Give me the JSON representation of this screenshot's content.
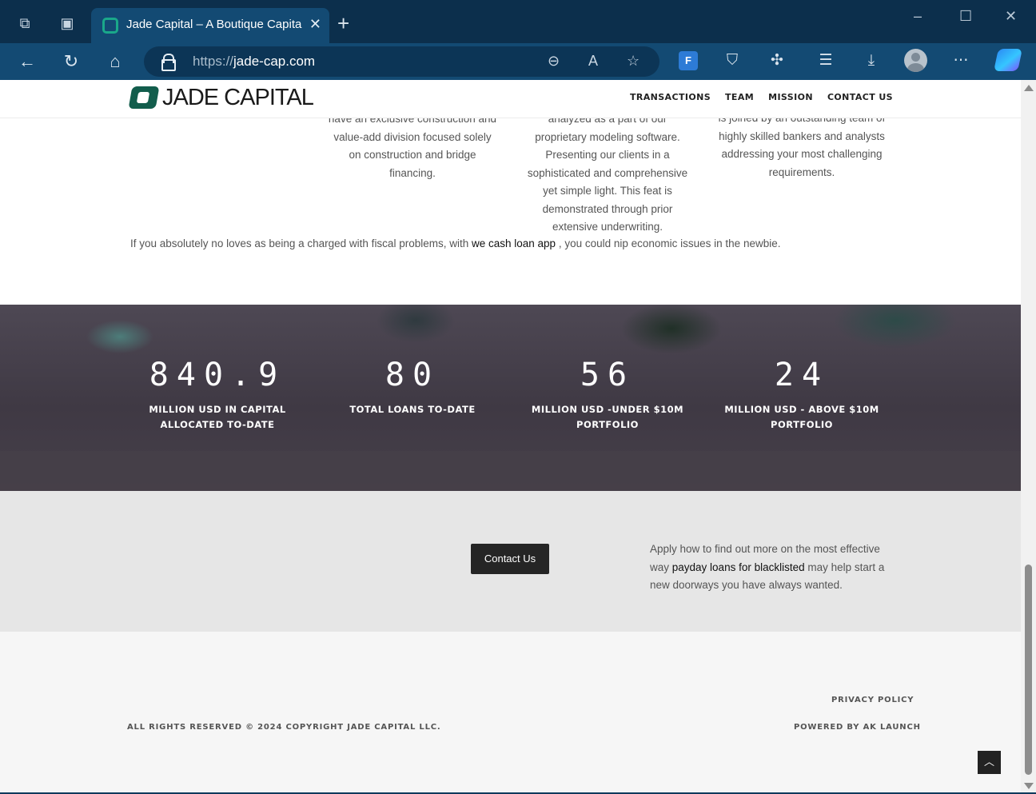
{
  "browser": {
    "tab_title": "Jade Capital – A Boutique Capital",
    "url_protocol": "https://",
    "url_host": "jade-cap.com",
    "icons": [
      "workspaces-icon",
      "tab-actions-icon",
      "favicon",
      "close-icon",
      "new-tab-icon",
      "back-icon",
      "refresh-icon",
      "home-icon",
      "lock-icon",
      "zoom-out-icon",
      "read-aloud-icon",
      "favorite-star-icon",
      "extension-icon",
      "shield-icon",
      "puzzle-icon",
      "favorites-icon",
      "downloads-icon",
      "profile-avatar",
      "more-icon",
      "copilot-icon"
    ]
  },
  "site": {
    "logo_text": "JADE CAPITAL",
    "nav": [
      "TRANSACTIONS",
      "TEAM",
      "MISSION",
      "CONTACT US"
    ],
    "brand_color": "#125d4c"
  },
  "columns": [
    [
      "have an exclusive construction and",
      "value-add division focused solely",
      "on construction and bridge",
      "financing."
    ],
    [
      "analyzed as a part of our",
      "proprietary modeling software.",
      "Presenting our clients in a",
      "sophisticated and comprehensive",
      "yet simple light. This feat is",
      "demonstrated through prior",
      "extensive underwriting."
    ],
    [
      "is joined by an outstanding team of",
      "highly skilled bankers and analysts",
      "addressing your most challenging",
      "requirements."
    ]
  ],
  "note": {
    "before": "If you absolutely no loves as being a charged with fiscal problems, with ",
    "link": "we cash loan app",
    "after": " , you could nip economic issues in the newbie."
  },
  "stats": [
    {
      "value": "840.9",
      "label_line1": "MILLION USD IN CAPITAL",
      "label_line2": "ALLOCATED TO-DATE"
    },
    {
      "value": "80",
      "label_line1": "TOTAL LOANS TO-DATE",
      "label_line2": ""
    },
    {
      "value": "56",
      "label_line1": "MILLION USD -UNDER $10M",
      "label_line2": "PORTFOLIO"
    },
    {
      "value": "24",
      "label_line1": "MILLION USD - ABOVE $10M",
      "label_line2": "PORTFOLIO"
    }
  ],
  "contact": {
    "button": "Contact Us",
    "text_before": "Apply how to find out more on the most effective way ",
    "text_link": "payday loans for blacklisted",
    "text_after": " may help start a new doorways you have always wanted."
  },
  "footer": {
    "copyright": "ALL RIGHTS RESERVED © 2024 COPYRIGHT JADE CAPITAL LLC.",
    "privacy": "PRIVACY POLICY",
    "powered": "POWERED BY AK LAUNCH"
  }
}
